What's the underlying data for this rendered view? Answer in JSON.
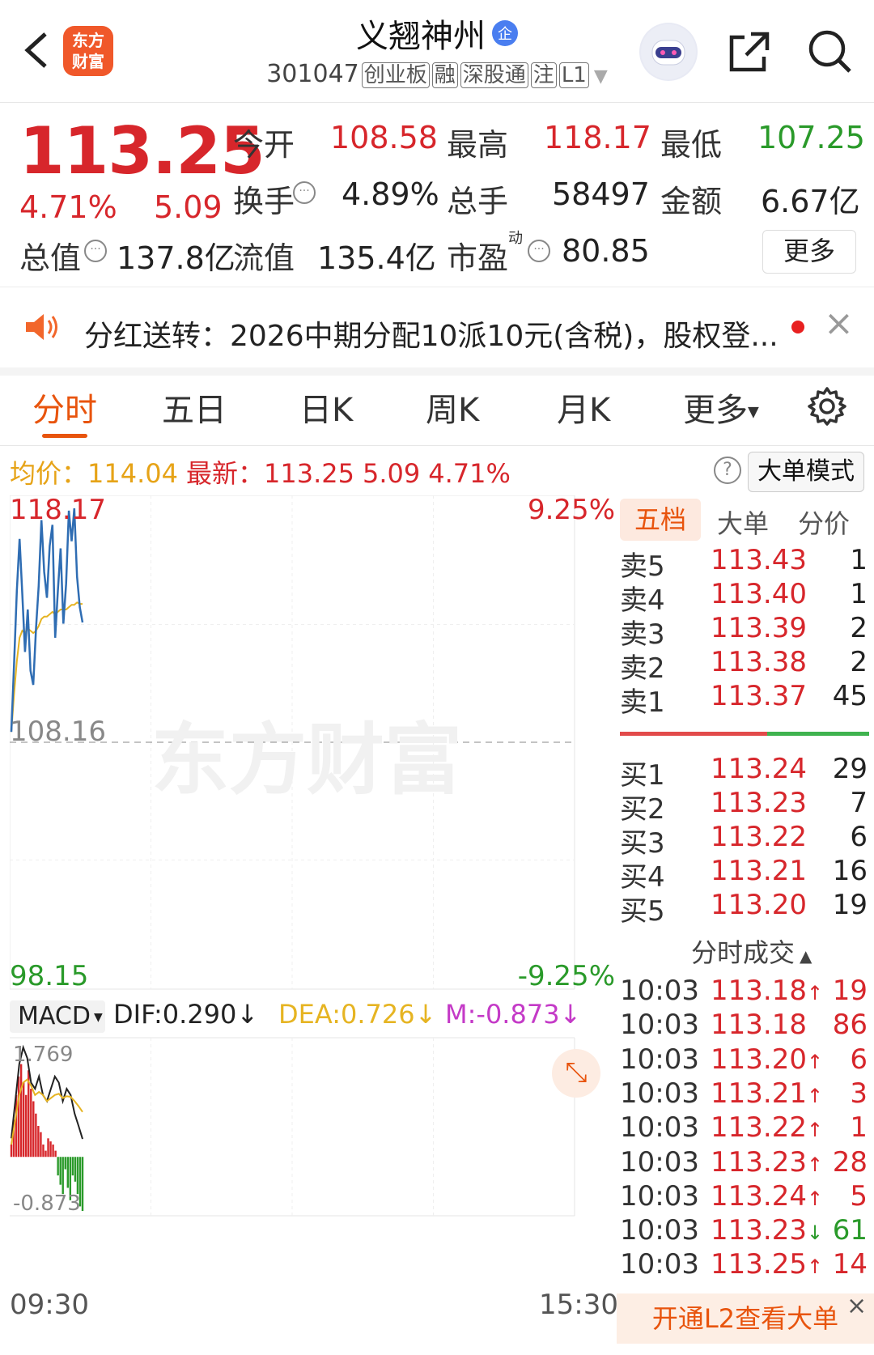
{
  "header": {
    "title": "义翘神州",
    "title_badge": "企",
    "logo_text_1": "东方",
    "logo_text_2": "财富",
    "code": "301047",
    "tags": [
      "创业板",
      "融",
      "深股通",
      "注",
      "L1"
    ]
  },
  "quote": {
    "price": "113.25",
    "change_pct": "4.71%",
    "change": "5.09",
    "open_label": "今开",
    "open": "108.58",
    "high_label": "最高",
    "high": "118.17",
    "low_label": "最低",
    "low": "107.25",
    "turnover_label": "换手",
    "turnover": "4.89%",
    "volume_label": "总手",
    "volume": "58497",
    "amount_label": "金额",
    "amount": "6.67亿",
    "mktcap_label": "总值",
    "mktcap": "137.8亿",
    "float_label": "流值",
    "float": "135.4亿",
    "pe_label": "市盈",
    "pe_sup": "动",
    "pe": "80.85",
    "more": "更多"
  },
  "notice": {
    "text": "分红送转：2026中期分配10派10元(含税)，股权登..."
  },
  "tabs": [
    "分时",
    "五日",
    "日K",
    "周K",
    "月K",
    "更多"
  ],
  "summary": {
    "avg_label": "均价：",
    "avg": "114.04",
    "last_label": "最新：",
    "last": "113.25",
    "chg": "5.09",
    "pct": "4.71%",
    "mode_button": "大单模式"
  },
  "chart_labels": {
    "top_price": "118.17",
    "top_pct": "9.25%",
    "mid_price": "108.16",
    "bottom_price": "98.15",
    "bottom_pct": "-9.25%",
    "watermark": "东方财富",
    "macd_select": "MACD",
    "dif": "DIF:0.290",
    "dea": "DEA:0.726",
    "m": "M:-0.873",
    "macd_top": "1.769",
    "macd_bottom": "-0.873",
    "time_start": "09:30",
    "time_end": "15:30"
  },
  "chart_data": {
    "type": "line",
    "title": "",
    "ylim": [
      98.15,
      118.17
    ],
    "pre_close": 108.16,
    "series": [
      {
        "values": [
          108.6,
          111.5,
          114.6,
          116.8,
          114.5,
          112.0,
          113.8,
          111.2,
          110.6,
          113.0,
          114.8,
          117.6,
          115.4,
          114.3,
          116.5,
          117.4,
          112.6,
          114.6,
          116.4,
          113.2,
          114.9,
          118.0,
          116.7,
          118.1,
          115.2,
          113.9,
          113.25
        ]
      },
      {
        "values": [
          108.6,
          110.2,
          111.6,
          112.6,
          112.9,
          112.8,
          113.0,
          112.9,
          112.8,
          112.9,
          113.1,
          113.4,
          113.5,
          113.5,
          113.6,
          113.7,
          113.6,
          113.7,
          113.8,
          113.8,
          113.8,
          113.9,
          114.0,
          114.0,
          114.1,
          114.04,
          114.04
        ]
      }
    ],
    "macd": {
      "ylim": [
        -0.873,
        1.769
      ],
      "bars": [
        0.2,
        0.6,
        1.0,
        1.3,
        1.5,
        1.2,
        1.0,
        1.4,
        1.1,
        0.9,
        0.7,
        0.5,
        0.4,
        0.2,
        0.1,
        0.3,
        0.25,
        0.2,
        0.1,
        -0.3,
        -0.45,
        -0.6,
        -0.2,
        -0.5,
        -0.7,
        -0.3,
        -0.4,
        -0.6,
        -0.8,
        -0.873
      ],
      "dif": [
        0.3,
        0.9,
        1.5,
        1.769,
        1.6,
        1.2,
        1.1,
        1.3,
        1.0,
        0.9,
        1.1,
        1.3,
        1.2,
        0.9,
        1.1,
        1.0,
        0.7,
        0.5,
        0.29
      ],
      "dea": [
        0.2,
        0.6,
        1.0,
        1.2,
        1.25,
        1.15,
        1.0,
        1.05,
        1.0,
        0.9,
        0.95,
        1.0,
        1.02,
        0.95,
        0.98,
        0.97,
        0.9,
        0.82,
        0.726
      ]
    }
  },
  "orderbook": {
    "tabs": [
      "五档",
      "大单",
      "分价"
    ],
    "asks": [
      {
        "label": "卖5",
        "price": "113.43",
        "vol": "1"
      },
      {
        "label": "卖4",
        "price": "113.40",
        "vol": "1"
      },
      {
        "label": "卖3",
        "price": "113.39",
        "vol": "2"
      },
      {
        "label": "卖2",
        "price": "113.38",
        "vol": "2"
      },
      {
        "label": "卖1",
        "price": "113.37",
        "vol": "45"
      }
    ],
    "bids": [
      {
        "label": "买1",
        "price": "113.24",
        "vol": "29"
      },
      {
        "label": "买2",
        "price": "113.23",
        "vol": "7"
      },
      {
        "label": "买3",
        "price": "113.22",
        "vol": "6"
      },
      {
        "label": "买4",
        "price": "113.21",
        "vol": "16"
      },
      {
        "label": "买5",
        "price": "113.20",
        "vol": "19"
      }
    ]
  },
  "ticks": {
    "title": "分时成交",
    "rows": [
      {
        "time": "10:03",
        "price": "113.18",
        "arrow": "↑",
        "vol": "19",
        "dir": "up"
      },
      {
        "time": "10:03",
        "price": "113.18",
        "arrow": "",
        "vol": "86",
        "dir": "up"
      },
      {
        "time": "10:03",
        "price": "113.20",
        "arrow": "↑",
        "vol": "6",
        "dir": "up"
      },
      {
        "time": "10:03",
        "price": "113.21",
        "arrow": "↑",
        "vol": "3",
        "dir": "up"
      },
      {
        "time": "10:03",
        "price": "113.22",
        "arrow": "↑",
        "vol": "1",
        "dir": "up"
      },
      {
        "time": "10:03",
        "price": "113.23",
        "arrow": "↑",
        "vol": "28",
        "dir": "up"
      },
      {
        "time": "10:03",
        "price": "113.24",
        "arrow": "↑",
        "vol": "5",
        "dir": "up"
      },
      {
        "time": "10:03",
        "price": "113.23",
        "arrow": "↓",
        "vol": "61",
        "dir": "down"
      },
      {
        "time": "10:03",
        "price": "113.25",
        "arrow": "↑",
        "vol": "14",
        "dir": "up"
      }
    ]
  },
  "bottom": {
    "l2_button": "开通L2查看大单"
  },
  "colors": {
    "up": "#d7262b",
    "down": "#2a9a2a",
    "accent": "#e8540d",
    "price_line": "#2f6db3",
    "avg_line": "#e6b422"
  }
}
